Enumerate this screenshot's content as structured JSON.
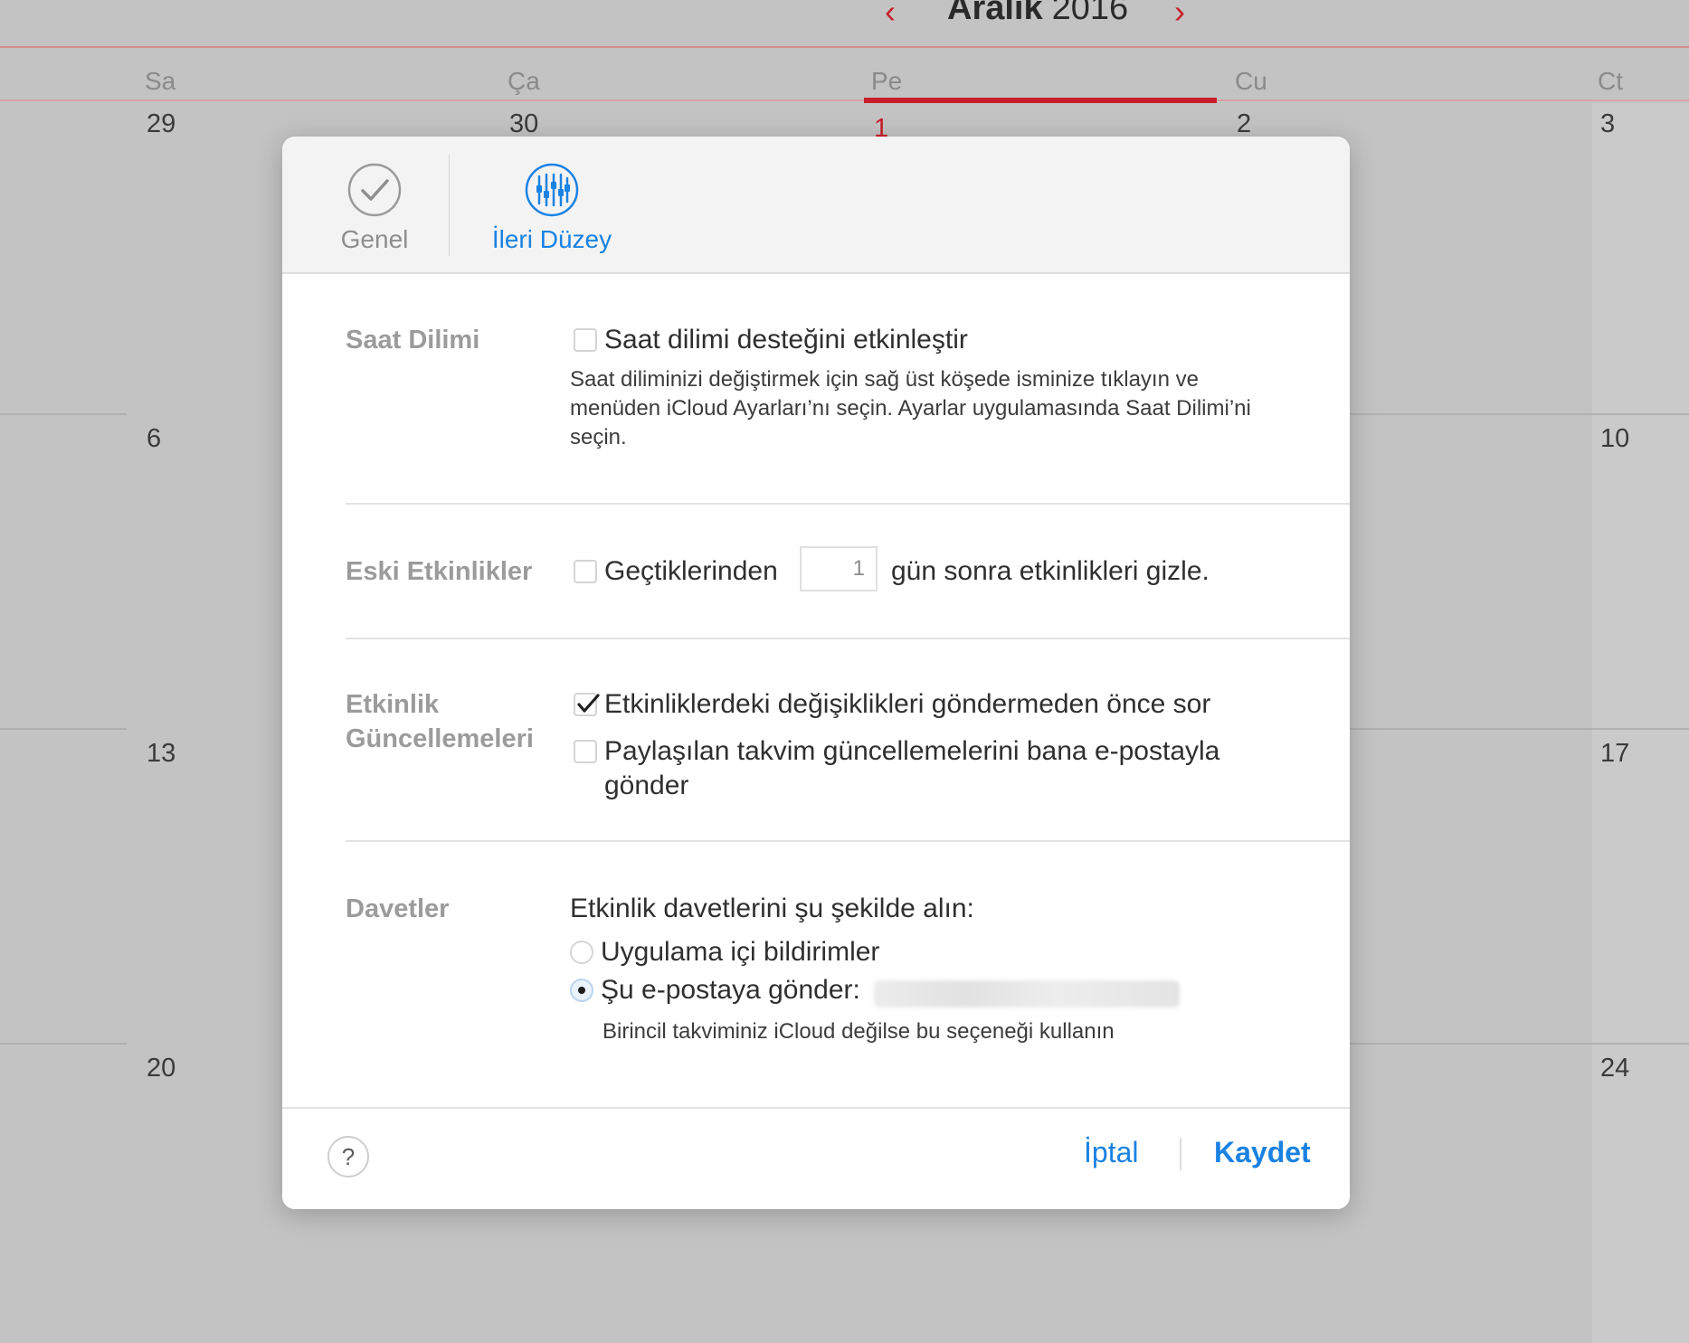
{
  "calendar": {
    "month": "Aralık",
    "year": "2016",
    "day_names": [
      "Sa",
      "Ça",
      "Pe",
      "Cu",
      "Ct"
    ],
    "dates": {
      "row1": [
        "29",
        "30",
        "1",
        "2",
        "3"
      ],
      "row2_first": "6",
      "row2_last": "10",
      "row3_first": "13",
      "row3_last": "17",
      "row4_first": "20",
      "row4_last": "24"
    },
    "accent_color": "#c81e2a"
  },
  "dialog": {
    "tabs": {
      "general": "Genel",
      "advanced": "İleri Düzey"
    },
    "timezone": {
      "label": "Saat Dilimi",
      "checkbox_label": "Saat dilimi desteğini etkinleştir",
      "checked": false,
      "help": "Saat diliminizi değiştirmek için sağ üst köşede isminize tıklayın ve menüden iCloud Ayarları’nı seçin. Ayarlar uygulamasında Saat Dilimi’ni seçin."
    },
    "old_events": {
      "label": "Eski Etkinlikler",
      "prefix": "Geçtiklerinden",
      "days_value": "1",
      "suffix": "gün sonra etkinlikleri gizle.",
      "checked": false
    },
    "event_updates": {
      "label_line1": "Etkinlik",
      "label_line2": "Güncellemeleri",
      "option1": "Etkinliklerdeki değişiklikleri göndermeden önce sor",
      "option1_checked": true,
      "option2_line1": "Paylaşılan takvim güncellemelerini bana e-postayla",
      "option2_line2": "gönder",
      "option2_checked": false
    },
    "invitations": {
      "label": "Davetler",
      "intro": "Etkinlik davetlerini şu şekilde alın:",
      "radio1": "Uygulama içi bildirimler",
      "radio2": "Şu e-postaya gönder:",
      "selected": "radio2",
      "note": "Birincil takviminiz iCloud değilse bu seçeneği kullanın"
    },
    "footer": {
      "help": "?",
      "cancel": "İptal",
      "save": "Kaydet"
    },
    "accent_color": "#1a82e2"
  }
}
